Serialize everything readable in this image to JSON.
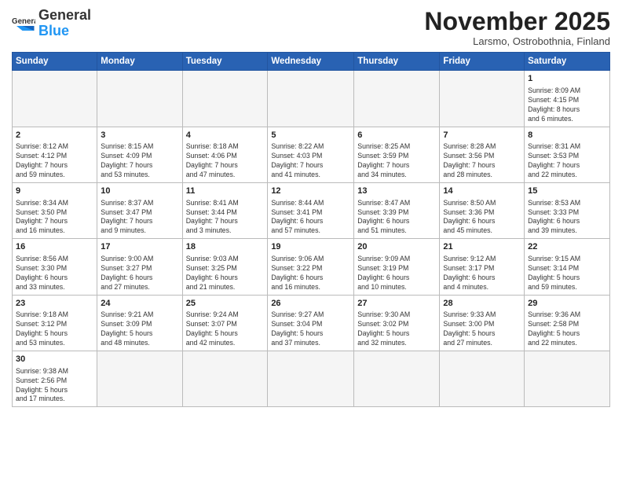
{
  "header": {
    "logo_general": "General",
    "logo_blue": "Blue",
    "month_title": "November 2025",
    "subtitle": "Larsmo, Ostrobothnia, Finland"
  },
  "weekdays": [
    "Sunday",
    "Monday",
    "Tuesday",
    "Wednesday",
    "Thursday",
    "Friday",
    "Saturday"
  ],
  "weeks": [
    [
      {
        "day": "",
        "info": ""
      },
      {
        "day": "",
        "info": ""
      },
      {
        "day": "",
        "info": ""
      },
      {
        "day": "",
        "info": ""
      },
      {
        "day": "",
        "info": ""
      },
      {
        "day": "",
        "info": ""
      },
      {
        "day": "1",
        "info": "Sunrise: 8:09 AM\nSunset: 4:15 PM\nDaylight: 8 hours\nand 6 minutes."
      }
    ],
    [
      {
        "day": "2",
        "info": "Sunrise: 8:12 AM\nSunset: 4:12 PM\nDaylight: 7 hours\nand 59 minutes."
      },
      {
        "day": "3",
        "info": "Sunrise: 8:15 AM\nSunset: 4:09 PM\nDaylight: 7 hours\nand 53 minutes."
      },
      {
        "day": "4",
        "info": "Sunrise: 8:18 AM\nSunset: 4:06 PM\nDaylight: 7 hours\nand 47 minutes."
      },
      {
        "day": "5",
        "info": "Sunrise: 8:22 AM\nSunset: 4:03 PM\nDaylight: 7 hours\nand 41 minutes."
      },
      {
        "day": "6",
        "info": "Sunrise: 8:25 AM\nSunset: 3:59 PM\nDaylight: 7 hours\nand 34 minutes."
      },
      {
        "day": "7",
        "info": "Sunrise: 8:28 AM\nSunset: 3:56 PM\nDaylight: 7 hours\nand 28 minutes."
      },
      {
        "day": "8",
        "info": "Sunrise: 8:31 AM\nSunset: 3:53 PM\nDaylight: 7 hours\nand 22 minutes."
      }
    ],
    [
      {
        "day": "9",
        "info": "Sunrise: 8:34 AM\nSunset: 3:50 PM\nDaylight: 7 hours\nand 16 minutes."
      },
      {
        "day": "10",
        "info": "Sunrise: 8:37 AM\nSunset: 3:47 PM\nDaylight: 7 hours\nand 9 minutes."
      },
      {
        "day": "11",
        "info": "Sunrise: 8:41 AM\nSunset: 3:44 PM\nDaylight: 7 hours\nand 3 minutes."
      },
      {
        "day": "12",
        "info": "Sunrise: 8:44 AM\nSunset: 3:41 PM\nDaylight: 6 hours\nand 57 minutes."
      },
      {
        "day": "13",
        "info": "Sunrise: 8:47 AM\nSunset: 3:39 PM\nDaylight: 6 hours\nand 51 minutes."
      },
      {
        "day": "14",
        "info": "Sunrise: 8:50 AM\nSunset: 3:36 PM\nDaylight: 6 hours\nand 45 minutes."
      },
      {
        "day": "15",
        "info": "Sunrise: 8:53 AM\nSunset: 3:33 PM\nDaylight: 6 hours\nand 39 minutes."
      }
    ],
    [
      {
        "day": "16",
        "info": "Sunrise: 8:56 AM\nSunset: 3:30 PM\nDaylight: 6 hours\nand 33 minutes."
      },
      {
        "day": "17",
        "info": "Sunrise: 9:00 AM\nSunset: 3:27 PM\nDaylight: 6 hours\nand 27 minutes."
      },
      {
        "day": "18",
        "info": "Sunrise: 9:03 AM\nSunset: 3:25 PM\nDaylight: 6 hours\nand 21 minutes."
      },
      {
        "day": "19",
        "info": "Sunrise: 9:06 AM\nSunset: 3:22 PM\nDaylight: 6 hours\nand 16 minutes."
      },
      {
        "day": "20",
        "info": "Sunrise: 9:09 AM\nSunset: 3:19 PM\nDaylight: 6 hours\nand 10 minutes."
      },
      {
        "day": "21",
        "info": "Sunrise: 9:12 AM\nSunset: 3:17 PM\nDaylight: 6 hours\nand 4 minutes."
      },
      {
        "day": "22",
        "info": "Sunrise: 9:15 AM\nSunset: 3:14 PM\nDaylight: 5 hours\nand 59 minutes."
      }
    ],
    [
      {
        "day": "23",
        "info": "Sunrise: 9:18 AM\nSunset: 3:12 PM\nDaylight: 5 hours\nand 53 minutes."
      },
      {
        "day": "24",
        "info": "Sunrise: 9:21 AM\nSunset: 3:09 PM\nDaylight: 5 hours\nand 48 minutes."
      },
      {
        "day": "25",
        "info": "Sunrise: 9:24 AM\nSunset: 3:07 PM\nDaylight: 5 hours\nand 42 minutes."
      },
      {
        "day": "26",
        "info": "Sunrise: 9:27 AM\nSunset: 3:04 PM\nDaylight: 5 hours\nand 37 minutes."
      },
      {
        "day": "27",
        "info": "Sunrise: 9:30 AM\nSunset: 3:02 PM\nDaylight: 5 hours\nand 32 minutes."
      },
      {
        "day": "28",
        "info": "Sunrise: 9:33 AM\nSunset: 3:00 PM\nDaylight: 5 hours\nand 27 minutes."
      },
      {
        "day": "29",
        "info": "Sunrise: 9:36 AM\nSunset: 2:58 PM\nDaylight: 5 hours\nand 22 minutes."
      }
    ],
    [
      {
        "day": "30",
        "info": "Sunrise: 9:38 AM\nSunset: 2:56 PM\nDaylight: 5 hours\nand 17 minutes."
      },
      {
        "day": "",
        "info": ""
      },
      {
        "day": "",
        "info": ""
      },
      {
        "day": "",
        "info": ""
      },
      {
        "day": "",
        "info": ""
      },
      {
        "day": "",
        "info": ""
      },
      {
        "day": "",
        "info": ""
      }
    ]
  ]
}
